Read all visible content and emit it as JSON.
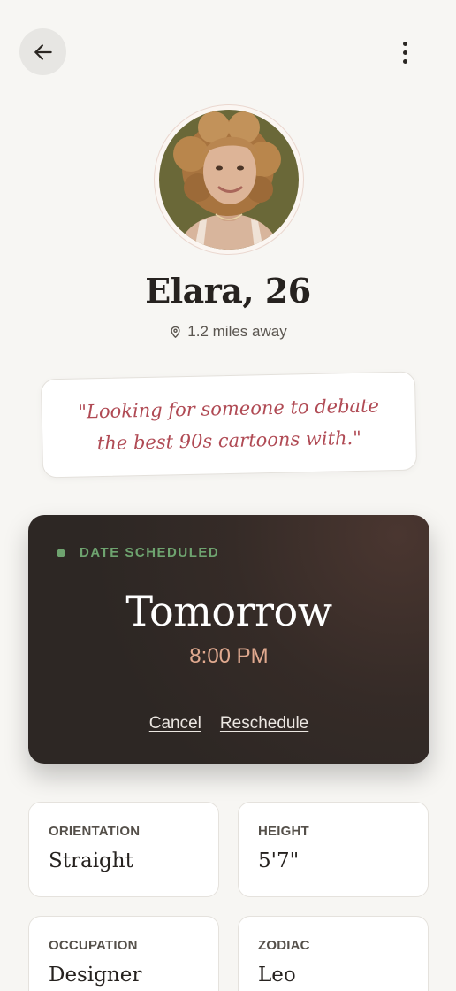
{
  "header": {
    "back_icon": "arrow-left-icon",
    "menu_icon": "more-vertical-icon"
  },
  "profile": {
    "name_age": "Elara, 26",
    "distance_icon": "map-pin-icon",
    "distance": "1.2 miles away",
    "quote": "\"Looking for someone to debate the best 90s cartoons with.\""
  },
  "date": {
    "status": "DATE SCHEDULED",
    "day": "Tomorrow",
    "time": "8:00 PM",
    "cancel_label": "Cancel",
    "reschedule_label": "Reschedule"
  },
  "details": [
    {
      "label": "ORIENTATION",
      "value": "Straight"
    },
    {
      "label": "HEIGHT",
      "value": "5'7\""
    },
    {
      "label": "OCCUPATION",
      "value": "Designer"
    },
    {
      "label": "ZODIAC",
      "value": "Leo"
    }
  ],
  "colors": {
    "background": "#f7f6f3",
    "quote_text": "#b04a54",
    "status_green": "#6ea36f",
    "time_accent": "#e0a98f",
    "date_card_bg": "#2d2724"
  }
}
